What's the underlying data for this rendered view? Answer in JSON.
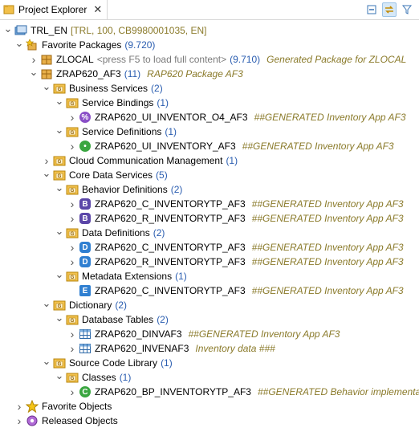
{
  "view": {
    "title": "Project Explorer",
    "close_icon": "close-icon"
  },
  "toolbar": {
    "icons": [
      "collapse-all-icon",
      "link-with-editor-icon",
      "filter-icon"
    ]
  },
  "tree": [
    {
      "level": 0,
      "expand": "down",
      "icon": "project-icon",
      "label": "TRL_EN",
      "count": "",
      "extra": "[TRL, 100, CB9980001035, EN]",
      "desc": ""
    },
    {
      "level": 1,
      "expand": "down",
      "icon": "favorite-packages-icon",
      "label": "Favorite Packages",
      "count": "(9.720)",
      "extra": "",
      "desc": ""
    },
    {
      "level": 2,
      "expand": "right",
      "icon": "package-icon",
      "label": "ZLOCAL",
      "count": "(9.710)",
      "extra": "<press F5 to load full content>",
      "desc": "Generated Package for ZLOCAL",
      "extra_before_count": true
    },
    {
      "level": 2,
      "expand": "down",
      "icon": "package-icon",
      "label": "ZRAP620_AF3",
      "count": "(11)",
      "extra": "",
      "desc": "RAP620 Package AF3"
    },
    {
      "level": 3,
      "expand": "down",
      "icon": "folder-icon",
      "label": "Business Services",
      "count": "(2)",
      "extra": "",
      "desc": ""
    },
    {
      "level": 4,
      "expand": "down",
      "icon": "folder-icon",
      "label": "Service Bindings",
      "count": "(1)",
      "extra": "",
      "desc": ""
    },
    {
      "level": 5,
      "expand": "right",
      "icon": "service-binding-icon",
      "label": "ZRAP620_UI_INVENTOR_O4_AF3",
      "count": "",
      "extra": "",
      "desc": "##GENERATED Inventory App AF3"
    },
    {
      "level": 4,
      "expand": "down",
      "icon": "folder-icon",
      "label": "Service Definitions",
      "count": "(1)",
      "extra": "",
      "desc": ""
    },
    {
      "level": 5,
      "expand": "right",
      "icon": "service-definition-icon",
      "label": "ZRAP620_UI_INVENTORY_AF3",
      "count": "",
      "extra": "",
      "desc": "##GENERATED Inventory App AF3"
    },
    {
      "level": 3,
      "expand": "right",
      "icon": "folder-icon",
      "label": "Cloud Communication Management",
      "count": "(1)",
      "extra": "",
      "desc": ""
    },
    {
      "level": 3,
      "expand": "down",
      "icon": "folder-icon",
      "label": "Core Data Services",
      "count": "(5)",
      "extra": "",
      "desc": ""
    },
    {
      "level": 4,
      "expand": "down",
      "icon": "folder-icon",
      "label": "Behavior Definitions",
      "count": "(2)",
      "extra": "",
      "desc": ""
    },
    {
      "level": 5,
      "expand": "right",
      "icon": "behavior-definition-icon",
      "label": "ZRAP620_C_INVENTORYTP_AF3",
      "count": "",
      "extra": "",
      "desc": "##GENERATED Inventory App AF3"
    },
    {
      "level": 5,
      "expand": "right",
      "icon": "behavior-definition-icon",
      "label": "ZRAP620_R_INVENTORYTP_AF3",
      "count": "",
      "extra": "",
      "desc": "##GENERATED Inventory App AF3"
    },
    {
      "level": 4,
      "expand": "down",
      "icon": "folder-icon",
      "label": "Data Definitions",
      "count": "(2)",
      "extra": "",
      "desc": ""
    },
    {
      "level": 5,
      "expand": "right",
      "icon": "data-definition-icon",
      "label": "ZRAP620_C_INVENTORYTP_AF3",
      "count": "",
      "extra": "",
      "desc": "##GENERATED Inventory App AF3"
    },
    {
      "level": 5,
      "expand": "right",
      "icon": "data-definition-icon",
      "label": "ZRAP620_R_INVENTORYTP_AF3",
      "count": "",
      "extra": "",
      "desc": "##GENERATED Inventory App AF3"
    },
    {
      "level": 4,
      "expand": "down",
      "icon": "folder-icon",
      "label": "Metadata Extensions",
      "count": "(1)",
      "extra": "",
      "desc": ""
    },
    {
      "level": 5,
      "expand": "none",
      "icon": "metadata-extension-icon",
      "label": "ZRAP620_C_INVENTORYTP_AF3",
      "count": "",
      "extra": "",
      "desc": "##GENERATED Inventory App AF3"
    },
    {
      "level": 3,
      "expand": "down",
      "icon": "folder-icon",
      "label": "Dictionary",
      "count": "(2)",
      "extra": "",
      "desc": ""
    },
    {
      "level": 4,
      "expand": "down",
      "icon": "folder-icon",
      "label": "Database Tables",
      "count": "(2)",
      "extra": "",
      "desc": ""
    },
    {
      "level": 5,
      "expand": "right",
      "icon": "database-table-icon",
      "label": "ZRAP620_DINVAF3",
      "count": "",
      "extra": "",
      "desc": "##GENERATED Inventory App AF3"
    },
    {
      "level": 5,
      "expand": "right",
      "icon": "database-table-icon",
      "label": "ZRAP620_INVENAF3",
      "count": "",
      "extra": "",
      "desc": "Inventory data ###"
    },
    {
      "level": 3,
      "expand": "down",
      "icon": "folder-icon",
      "label": "Source Code Library",
      "count": "(1)",
      "extra": "",
      "desc": ""
    },
    {
      "level": 4,
      "expand": "down",
      "icon": "folder-icon",
      "label": "Classes",
      "count": "(1)",
      "extra": "",
      "desc": ""
    },
    {
      "level": 5,
      "expand": "right",
      "icon": "class-icon",
      "label": "ZRAP620_BP_INVENTORYTP_AF3",
      "count": "",
      "extra": "",
      "desc": "##GENERATED Behavior implementation"
    },
    {
      "level": 1,
      "expand": "right",
      "icon": "favorite-objects-icon",
      "label": "Favorite Objects",
      "count": "",
      "extra": "",
      "desc": ""
    },
    {
      "level": 1,
      "expand": "right",
      "icon": "released-objects-icon",
      "label": "Released Objects",
      "count": "",
      "extra": "",
      "desc": ""
    }
  ]
}
